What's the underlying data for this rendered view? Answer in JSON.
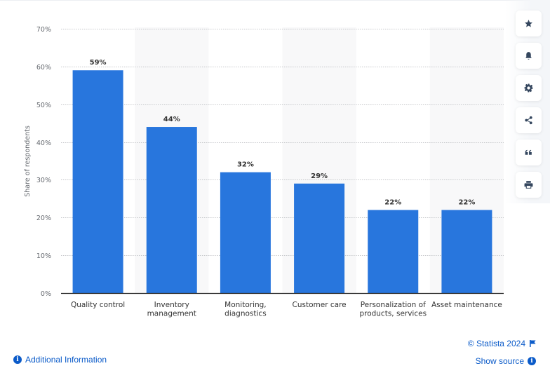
{
  "chart_data": {
    "type": "bar",
    "title": "",
    "xlabel": "",
    "ylabel": "Share of respondents",
    "ylim": [
      0,
      70
    ],
    "yticks": [
      0,
      10,
      20,
      30,
      40,
      50,
      60,
      70
    ],
    "ytick_format": "%",
    "grid": true,
    "categories": [
      [
        "Quality control"
      ],
      [
        "Inventory",
        "management"
      ],
      [
        "Monitoring,",
        "diagnostics"
      ],
      [
        "Customer care"
      ],
      [
        "Personalization of",
        "products, services"
      ],
      [
        "Asset maintenance"
      ]
    ],
    "values": [
      59,
      44,
      32,
      29,
      22,
      22
    ],
    "data_labels": [
      "59%",
      "44%",
      "32%",
      "29%",
      "22%",
      "22%"
    ],
    "bar_color": "#2876dd"
  },
  "toolbar": {
    "items": [
      {
        "name": "favorite",
        "icon": "star-icon"
      },
      {
        "name": "notification",
        "icon": "bell-icon"
      },
      {
        "name": "settings",
        "icon": "gear-icon"
      },
      {
        "name": "share",
        "icon": "share-icon"
      },
      {
        "name": "cite",
        "icon": "quote-icon"
      },
      {
        "name": "print",
        "icon": "print-icon"
      }
    ]
  },
  "footer": {
    "additional_info": "Additional Information",
    "copyright": "© Statista 2024",
    "show_source": "Show source"
  }
}
